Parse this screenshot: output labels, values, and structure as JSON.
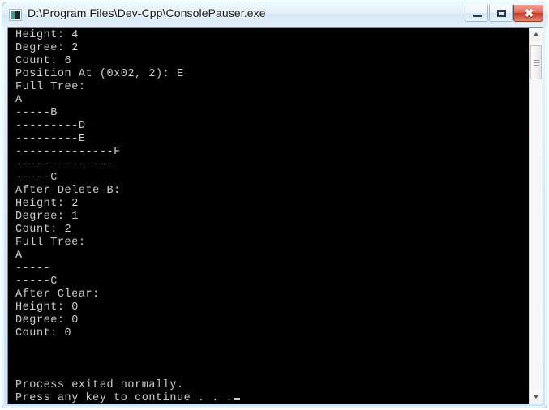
{
  "window": {
    "title": "D:\\Program Files\\Dev-Cpp\\ConsolePauser.exe",
    "icon": "console-app-icon",
    "controls": {
      "minimize_label": "–",
      "maximize_label": "□",
      "close_label": "✖"
    },
    "accent_close_color": "#c63d26",
    "frame_color": "#cfe3f5"
  },
  "console": {
    "background_color": "#000000",
    "foreground_color": "#cdcdcd",
    "lines": [
      "Height: 4",
      "Degree: 2",
      "Count: 6",
      "Position At (0x02, 2): E",
      "Full Tree:",
      "A",
      "-----B",
      "---------D",
      "---------E",
      "--------------F",
      "--------------",
      "-----C",
      "After Delete B:",
      "Height: 2",
      "Degree: 1",
      "Count: 2",
      "Full Tree:",
      "A",
      "-----",
      "-----C",
      "After Clear:",
      "Height: 0",
      "Degree: 0",
      "Count: 0",
      "",
      "",
      "",
      "Process exited normally."
    ],
    "prompt_line": "Press any key to continue . . .",
    "cursor": "block-cursor"
  },
  "scrollbar": {
    "up_arrow": "scroll-up-arrow",
    "down_arrow": "scroll-down-arrow",
    "thumb": "scroll-thumb",
    "orientation": "vertical"
  }
}
